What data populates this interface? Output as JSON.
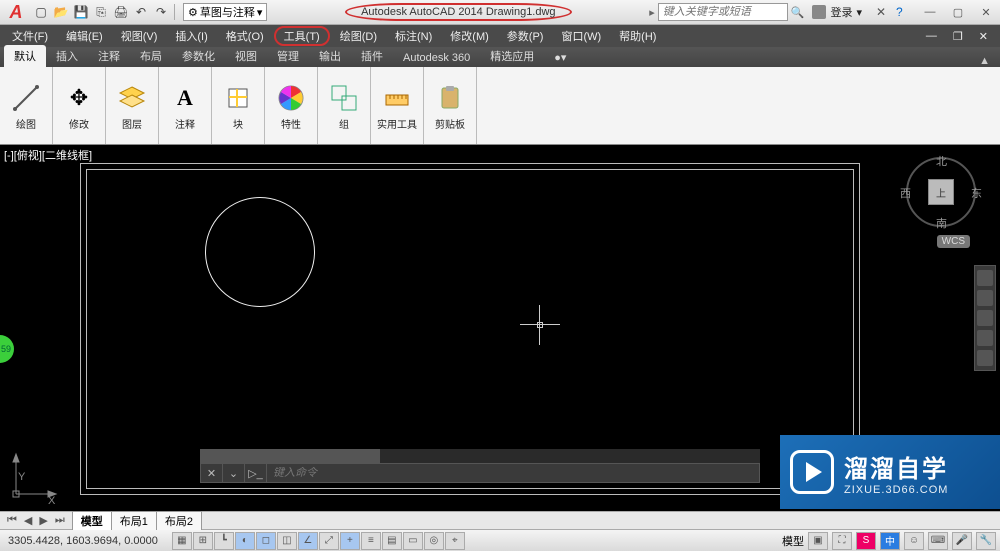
{
  "title": "Autodesk AutoCAD 2014    Drawing1.dwg",
  "workspace": "草图与注释",
  "search_placeholder": "键入关键字或短语",
  "login_label": "登录",
  "menus": [
    "文件(F)",
    "编辑(E)",
    "视图(V)",
    "插入(I)",
    "格式(O)",
    "工具(T)",
    "绘图(D)",
    "标注(N)",
    "修改(M)",
    "参数(P)",
    "窗口(W)",
    "帮助(H)"
  ],
  "menu_highlight_index": 5,
  "ribbon_tabs": [
    "默认",
    "插入",
    "注释",
    "布局",
    "参数化",
    "视图",
    "管理",
    "输出",
    "插件",
    "Autodesk 360",
    "精选应用"
  ],
  "ribbon_active": 0,
  "panels": {
    "draw": {
      "label": "绘图"
    },
    "modify": {
      "label": "修改"
    },
    "layer": {
      "label": "图层"
    },
    "annot": {
      "label": "注释"
    },
    "block": {
      "label": "块"
    },
    "prop": {
      "label": "特性"
    },
    "group": {
      "label": "组"
    },
    "util": {
      "label": "实用工具"
    },
    "clip": {
      "label": "剪贴板"
    }
  },
  "viewport_tag": "[-][俯视][二维线框]",
  "viewcube": {
    "top": "北",
    "bottom": "南",
    "left": "西",
    "right": "东",
    "face": "上"
  },
  "wcs_tag": "WCS",
  "ucs": {
    "x": "X",
    "y": "Y"
  },
  "green_tab": "59",
  "command_placeholder": "键入命令",
  "layout_tabs": [
    "模型",
    "布局1",
    "布局2"
  ],
  "layout_active": 0,
  "coords": "3305.4428, 1603.9694, 0.0000",
  "status_right": "模型",
  "watermark": {
    "zh": "溜溜自学",
    "url": "ZIXUE.3D66.COM"
  }
}
